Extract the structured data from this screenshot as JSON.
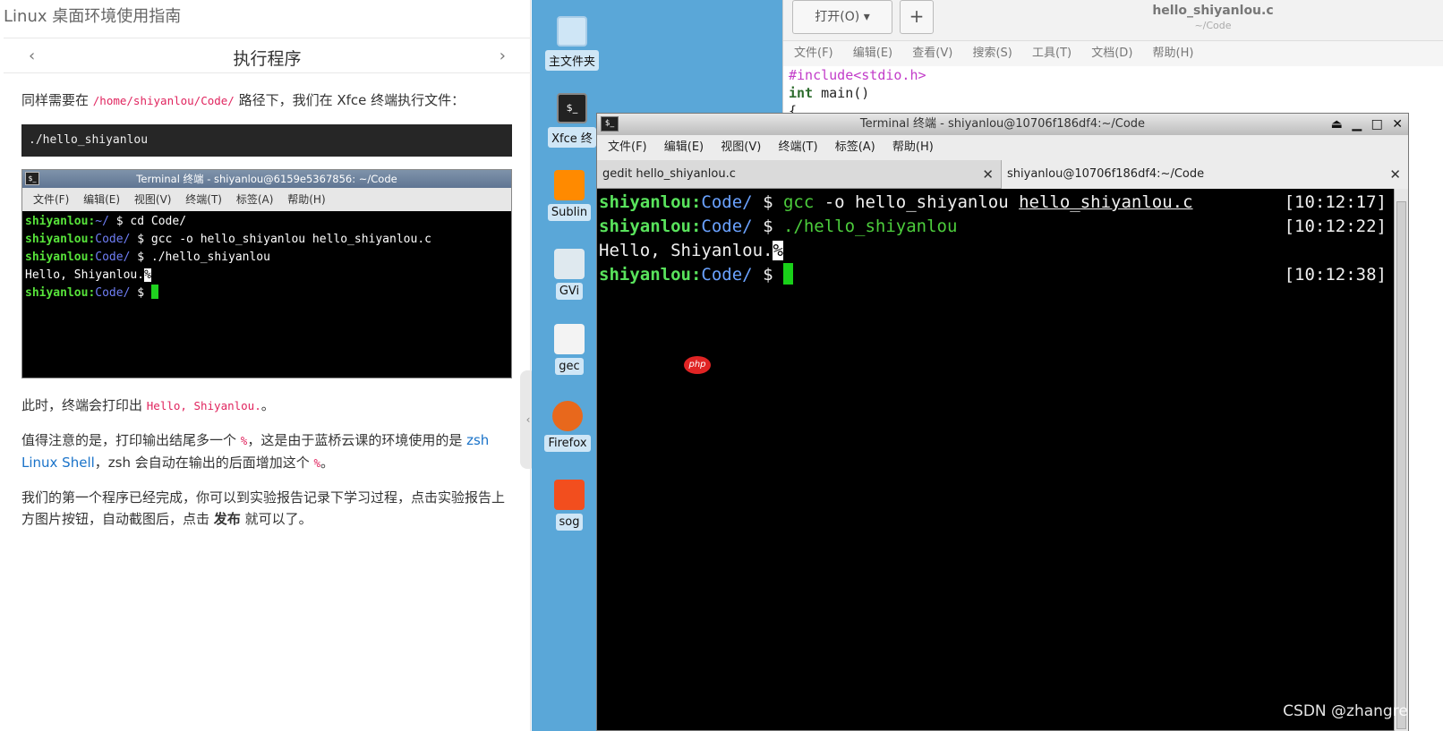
{
  "guide": {
    "title": "Linux 桌面环境使用指南",
    "section_title": "执行程序",
    "prev_icon": "‹",
    "next_icon": "›",
    "para1_prefix": "同样需要在 ",
    "para1_code": "/home/shiyanlou/Code/",
    "para1_suffix": " 路径下，我们在 Xfce 终端执行文件：",
    "code_block": "./hello_shiyanlou",
    "mini_terminal": {
      "title": "Terminal 终端 - shiyanlou@6159e5367856: ~/Code",
      "menu": [
        "文件(F)",
        "编辑(E)",
        "视图(V)",
        "终端(T)",
        "标签(A)",
        "帮助(H)"
      ],
      "user": "shiyanlou",
      "dir_home": "~/",
      "dir_code": "Code/",
      "cmd1": "cd Code/",
      "cmd2": "gcc -o hello_shiyanlou hello_shiyanlou.c",
      "cmd3": "./hello_shiyanlou",
      "output": "Hello, Shiyanlou."
    },
    "para2_prefix": "此时，终端会打印出 ",
    "para2_code": "Hello, Shiyanlou.",
    "para2_suffix": "。",
    "para3_a": "值得注意的是，打印输出结尾多一个 ",
    "para3_code1": "%",
    "para3_b": "，这是由于蓝桥云课的环境使用的是 ",
    "para3_link": "zsh Linux Shell",
    "para3_c": "，zsh 会自动在输出的后面增加这个 ",
    "para3_code2": "%",
    "para3_d": "。",
    "para4_a": "我们的第一个程序已经完成，你可以到实验报告记录下学习过程，点击实验报告上方图片按钮，自动截图后，点击 ",
    "para4_bold": "发布",
    "para4_b": " 就可以了。"
  },
  "desktop": {
    "icons": [
      {
        "label": "主文件夹",
        "icon": "home-folder-icon"
      },
      {
        "label": "Xfce 终",
        "icon": "terminal-icon"
      },
      {
        "label": "Sublin",
        "icon": "sublime-icon"
      },
      {
        "label": "GVi",
        "icon": "gvim-icon"
      },
      {
        "label": "gec",
        "icon": "gedit-icon"
      },
      {
        "label": "Firefox",
        "icon": "firefox-icon"
      },
      {
        "label": "sog",
        "icon": "sogou-icon"
      }
    ]
  },
  "gedit": {
    "open_label": "打开(O)",
    "add_label": "+",
    "title": "hello_shiyanlou.c",
    "subtitle": "~/Code",
    "menu": [
      "文件(F)",
      "编辑(E)",
      "查看(V)",
      "搜索(S)",
      "工具(T)",
      "文档(D)",
      "帮助(H)"
    ],
    "code_line1": "#include<stdio.h>",
    "code_line2_kw": "int",
    "code_line2_rest": " main()",
    "code_line3": "{"
  },
  "terminal": {
    "title": "Terminal 终端 - shiyanlou@10706f186df4:~/Code",
    "menu": [
      "文件(F)",
      "编辑(E)",
      "视图(V)",
      "终端(T)",
      "标签(A)",
      "帮助(H)"
    ],
    "tabs": [
      {
        "label": "gedit hello_shiyanlou.c"
      },
      {
        "label": "shiyanlou@10706f186df4:~/Code"
      }
    ],
    "user": "shiyanlou",
    "dir": "Code/",
    "prompt": "$",
    "line1_cmd": "gcc",
    "line1_args": " -o hello_shiyanlou ",
    "line1_file": "hello_shiyanlou.c",
    "line1_time": "[10:12:17]",
    "line2_cmd": "./hello_shiyanlou",
    "line2_time": "[10:12:22]",
    "output": "Hello, Shiyanlou.",
    "percent": "%",
    "line4_time": "[10:12:38]"
  },
  "badge": "php",
  "watermark": "CSDN @zhangrelay"
}
